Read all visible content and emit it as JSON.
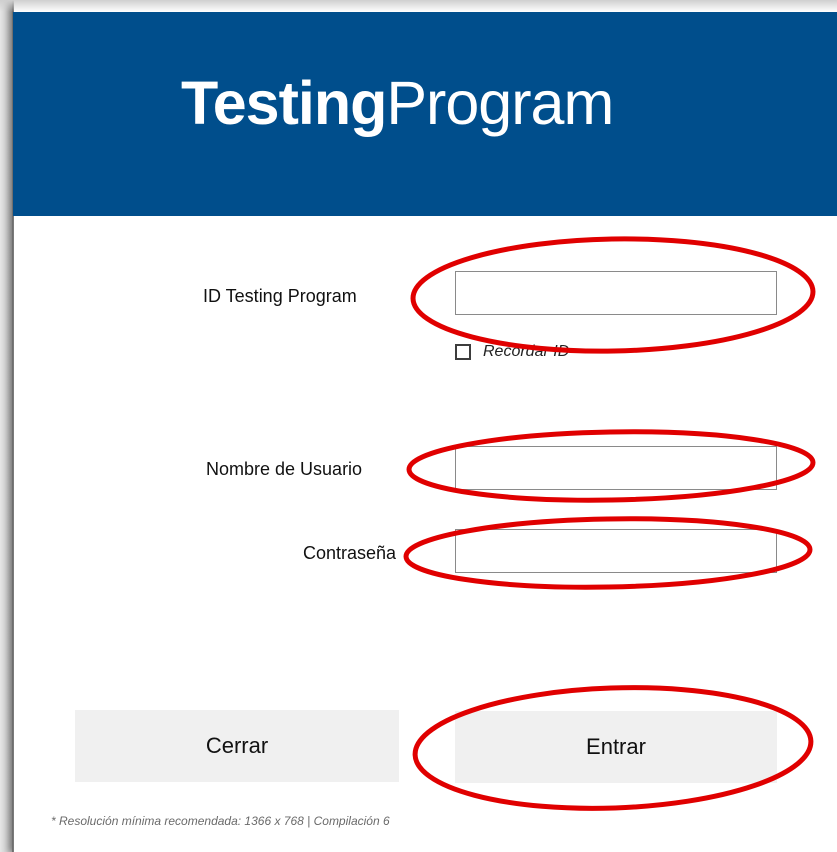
{
  "app": {
    "logo_bold": "Testing",
    "logo_light": "Program"
  },
  "form": {
    "id_label": "ID Testing Program",
    "id_value": "",
    "remember_label": "Recordar ID",
    "remember_checked": false,
    "username_label": "Nombre de Usuario",
    "username_value": "",
    "password_label": "Contraseña",
    "password_value": ""
  },
  "buttons": {
    "close_label": "Cerrar",
    "enter_label": "Entrar"
  },
  "footer": {
    "note": "* Resolución mínima recomendada: 1366 x 768  |  Compilación 6"
  },
  "colors": {
    "header_bg": "#004e8c",
    "annotation": "#e00000"
  }
}
